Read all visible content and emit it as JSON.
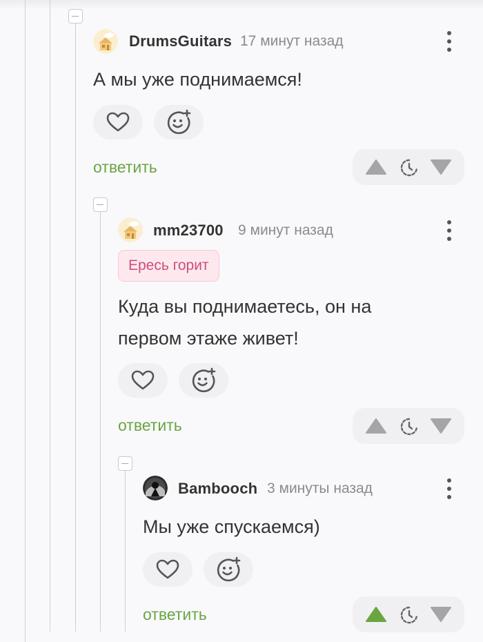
{
  "comments": [
    {
      "username": "DrumsGuitars",
      "time": "17 минут назад",
      "text_lines": [
        "А мы уже поднимаемся!"
      ],
      "reply_label": "ответить",
      "avatar_icon": "house-avatar-icon",
      "vote_up_active": false
    },
    {
      "username": "mm23700",
      "time": "9 минут назад",
      "tag": "Ересь горит",
      "text_lines": [
        "Куда вы поднимаетесь, он на",
        "первом этаже живет!"
      ],
      "reply_label": "ответить",
      "avatar_icon": "house-avatar-icon",
      "vote_up_active": false
    },
    {
      "username": "Bambooch",
      "time": "3 минуты назад",
      "text_lines": [
        "Мы уже спускаемся)"
      ],
      "reply_label": "ответить",
      "avatar_icon": "dark-photo-avatar-icon",
      "vote_up_active": true
    }
  ],
  "colors": {
    "reply_green": "#6ba542",
    "vote_active_green": "#6ba542",
    "vote_inactive_gray": "#a4a4a9",
    "tag_pink_text": "#cc4e7b",
    "tag_pink_bg": "#fde8ee"
  }
}
